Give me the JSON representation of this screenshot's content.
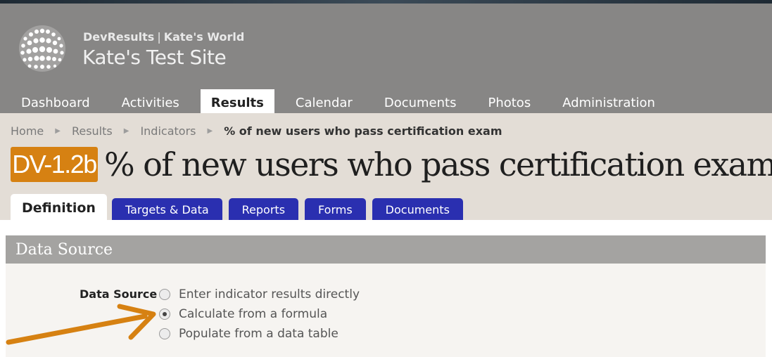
{
  "header": {
    "org_name": "DevResults",
    "org_separator": "|",
    "world_name": "Kate's World",
    "site_title": "Kate's Test Site"
  },
  "nav": {
    "items": [
      {
        "label": "Dashboard",
        "active": false
      },
      {
        "label": "Activities",
        "active": false
      },
      {
        "label": "Results",
        "active": true
      },
      {
        "label": "Calendar",
        "active": false
      },
      {
        "label": "Documents",
        "active": false
      },
      {
        "label": "Photos",
        "active": false
      },
      {
        "label": "Administration",
        "active": false
      }
    ]
  },
  "breadcrumb": {
    "items": [
      "Home",
      "Results",
      "Indicators",
      "% of new users who pass certification exam"
    ]
  },
  "indicator": {
    "code": "DV-1.2b",
    "title": "% of new users who pass certification exam"
  },
  "tabs": [
    {
      "label": "Definition",
      "active": true
    },
    {
      "label": "Targets & Data",
      "active": false
    },
    {
      "label": "Reports",
      "active": false
    },
    {
      "label": "Forms",
      "active": false
    },
    {
      "label": "Documents",
      "active": false
    }
  ],
  "section": {
    "title": "Data Source",
    "field_label": "Data Source",
    "options": [
      {
        "label": "Enter indicator results directly",
        "checked": false
      },
      {
        "label": "Calculate from a formula",
        "checked": true
      },
      {
        "label": "Populate from a data table",
        "checked": false
      }
    ]
  },
  "colors": {
    "header_bg": "#878685",
    "band_bg": "#e3ddd6",
    "badge": "#d68112",
    "tab_blue": "#2a2fb0",
    "annotation_arrow": "#d68112"
  }
}
